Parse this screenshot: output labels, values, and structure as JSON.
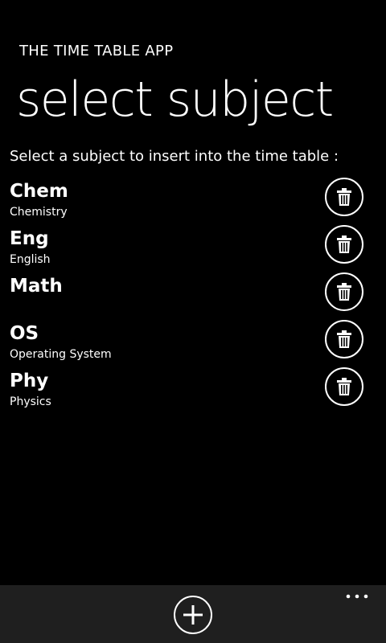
{
  "header": {
    "app_title": "THE TIME TABLE APP",
    "page_title": "select subject"
  },
  "instruction": "Select a subject to insert into the time table :",
  "subjects": [
    {
      "code": "Chem",
      "name": "Chemistry"
    },
    {
      "code": "Eng",
      "name": "English"
    },
    {
      "code": "Math",
      "name": ""
    },
    {
      "code": "OS",
      "name": "Operating System"
    },
    {
      "code": "Phy",
      "name": "Physics"
    }
  ],
  "icons": {
    "delete": "trash-icon",
    "add": "plus-icon",
    "more": "ellipsis-icon"
  },
  "colors": {
    "background": "#000000",
    "foreground": "#ffffff",
    "app_bar": "#1f1f1f"
  }
}
